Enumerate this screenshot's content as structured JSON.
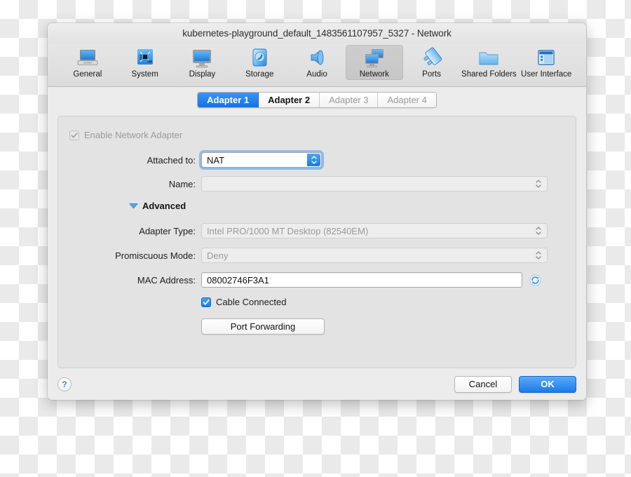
{
  "window": {
    "title": "kubernetes-playground_default_1483561107957_5327 - Network"
  },
  "toolbar": {
    "items": [
      {
        "label": "General",
        "icon": "laptop-icon",
        "selected": false
      },
      {
        "label": "System",
        "icon": "motherboard-icon",
        "selected": false
      },
      {
        "label": "Display",
        "icon": "monitor-icon",
        "selected": false
      },
      {
        "label": "Storage",
        "icon": "harddisk-icon",
        "selected": false
      },
      {
        "label": "Audio",
        "icon": "speaker-icon",
        "selected": false
      },
      {
        "label": "Network",
        "icon": "network-icon",
        "selected": true
      },
      {
        "label": "Ports",
        "icon": "plug-icon",
        "selected": false
      },
      {
        "label": "Shared Folders",
        "icon": "folder-icon",
        "selected": false
      },
      {
        "label": "User Interface",
        "icon": "window-icon",
        "selected": false
      }
    ]
  },
  "tabs": [
    {
      "label": "Adapter 1",
      "state": "active"
    },
    {
      "label": "Adapter 2",
      "state": "enabled"
    },
    {
      "label": "Adapter 3",
      "state": "disabled"
    },
    {
      "label": "Adapter 4",
      "state": "disabled"
    }
  ],
  "form": {
    "enable_adapter": {
      "label": "Enable Network Adapter",
      "checked": true,
      "enabled": false
    },
    "attached_to": {
      "label": "Attached to:",
      "value": "NAT",
      "enabled": true,
      "focused": true
    },
    "name": {
      "label": "Name:",
      "value": "",
      "enabled": false
    },
    "advanced": {
      "label": "Advanced",
      "expanded": true,
      "disclosure_icon": "triangle-down-icon"
    },
    "adapter_type": {
      "label": "Adapter Type:",
      "value": "Intel PRO/1000 MT Desktop (82540EM)",
      "enabled": false
    },
    "promiscuous_mode": {
      "label": "Promiscuous Mode:",
      "value": "Deny",
      "enabled": false
    },
    "mac_address": {
      "label": "MAC Address:",
      "value": "08002746F3A1",
      "enabled": true,
      "refresh_icon": "refresh-icon"
    },
    "cable_connected": {
      "label": "Cable Connected",
      "checked": true,
      "enabled": true
    },
    "port_forwarding": {
      "label": "Port Forwarding"
    }
  },
  "footer": {
    "help_label": "?",
    "cancel_label": "Cancel",
    "ok_label": "OK"
  },
  "colors": {
    "accent": "#1c7ae9",
    "tab_active": "#2b86ef",
    "disabled_text": "#9a9a9a",
    "window_bg": "#ececec",
    "panel_bg": "#e3e3e3"
  }
}
